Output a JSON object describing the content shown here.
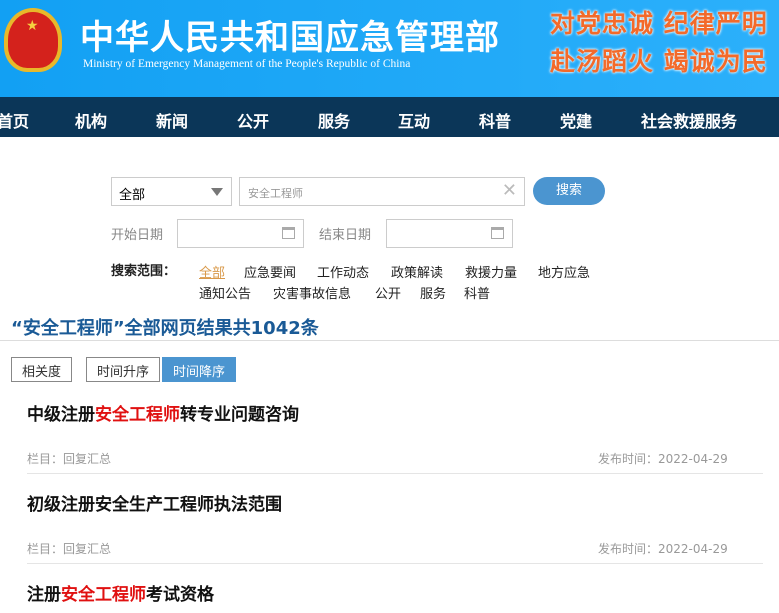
{
  "header": {
    "title": "中华人民共和国应急管理部",
    "subtitle": "Ministry of Emergency Management of the People's Republic of China",
    "slogan1": "对党忠诚 纪律严明",
    "slogan2": "赴汤蹈火 竭诚为民"
  },
  "nav": [
    "首页",
    "机构",
    "新闻",
    "公开",
    "服务",
    "互动",
    "科普",
    "党建",
    "社会救援服务"
  ],
  "search": {
    "scope_select": "全部",
    "query": "安全工程师",
    "button": "搜索",
    "start_label": "开始日期",
    "end_label": "结束日期",
    "range_label": "搜索范围：",
    "ranges": [
      "全部",
      "应急要闻",
      "工作动态",
      "政策解读",
      "救援力量",
      "地方应急",
      "通知公告",
      "灾害事故信息",
      "公开",
      "服务",
      "科普"
    ]
  },
  "results": {
    "summary": "“安全工程师”全部网页结果共1042条",
    "sort": [
      "相关度",
      "时间升序",
      "时间降序"
    ],
    "items": [
      {
        "pre": "中级注册",
        "hl": "安全工程师",
        "post": "转专业问题咨询",
        "column": "栏目：回复汇总",
        "date": "发布时间：2022-04-29"
      },
      {
        "pre": "初级注册安全生产工程师执法范围",
        "hl": "",
        "post": "",
        "column": "栏目：回复汇总",
        "date": "发布时间：2022-04-29"
      },
      {
        "pre": "注册",
        "hl": "安全工程师",
        "post": "考试资格",
        "column": "",
        "date": ""
      }
    ]
  }
}
